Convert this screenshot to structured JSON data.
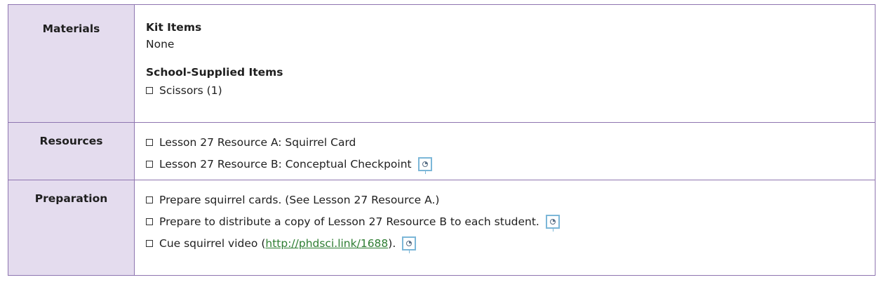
{
  "rows": {
    "materials": {
      "label": "Materials",
      "kit_heading": "Kit Items",
      "kit_value": "None",
      "school_heading": "School-Supplied Items",
      "school_items": [
        "Scissors (1)"
      ]
    },
    "resources": {
      "label": "Resources",
      "items": [
        "Lesson 27 Resource A: Squirrel Card",
        "Lesson 27 Resource B: Conceptual Checkpoint"
      ]
    },
    "preparation": {
      "label": "Preparation",
      "item1": "Prepare squirrel cards. (See Lesson 27 Resource A.)",
      "item2": "Prepare to distribute a copy of Lesson 27 Resource B to each student.",
      "item3_before": "Cue squirrel video (",
      "item3_link": "http://phdsci.link/1688",
      "item3_after": ")."
    }
  },
  "icons": {
    "projection": "projection-screen-icon"
  },
  "colors": {
    "border": "#8e75b0",
    "label_bg": "#e4dcee",
    "link": "#2e7d32",
    "icon": "#7cb7d8"
  }
}
